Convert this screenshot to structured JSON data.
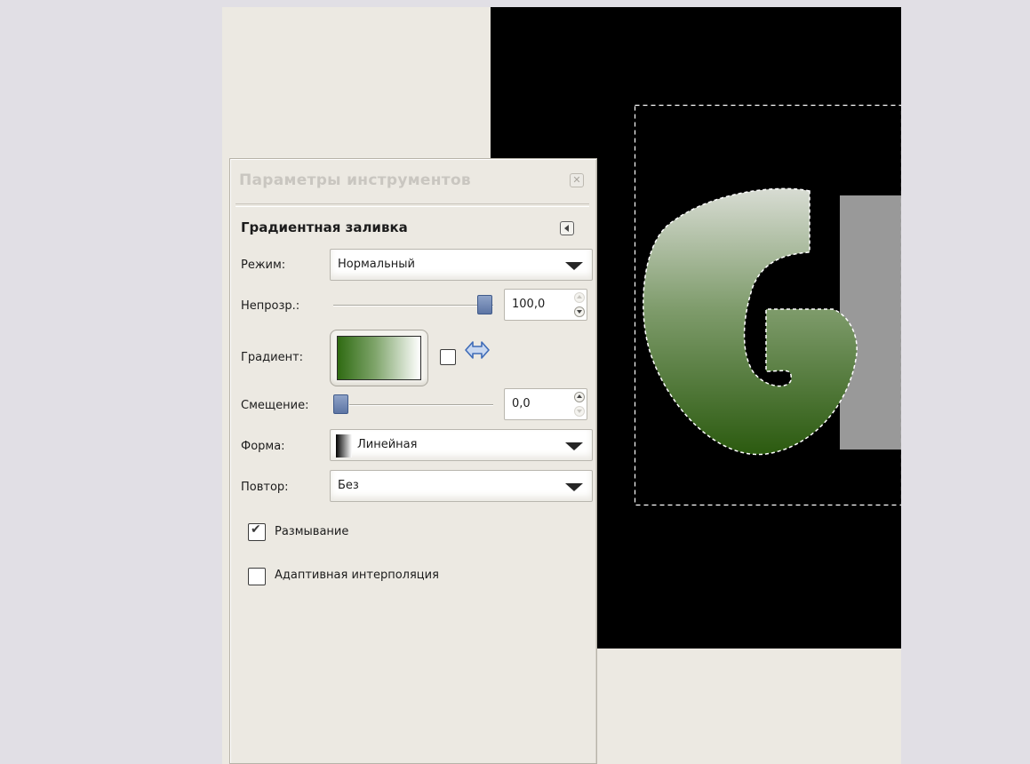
{
  "panel": {
    "title": "Параметры инструментов",
    "section_title": "Градиентная заливка"
  },
  "mode": {
    "label": "Режим:",
    "value": "Нормальный"
  },
  "opacity": {
    "label": "Непрозр.:",
    "value": "100,0",
    "fraction": 1.0
  },
  "gradient": {
    "label": "Градиент:",
    "reverse_checked": false
  },
  "offset": {
    "label": "Смещение:",
    "value": "0,0",
    "fraction": 0.0
  },
  "shape": {
    "label": "Форма:",
    "value": "Линейная"
  },
  "repeat": {
    "label": "Повтор:",
    "value": "Без"
  },
  "dither": {
    "label": "Размывание",
    "checked": true
  },
  "adaptive": {
    "label": "Адаптивная интерполяция",
    "checked": false
  },
  "canvas": {
    "letter": "G"
  },
  "icons": {
    "close": "close-icon",
    "collapse": "collapse-icon",
    "reverse": "reverse-gradient-icon",
    "dropdown": "chevron-down-icon"
  },
  "colors": {
    "gradient_start": "#2f6b12",
    "gradient_end": "#ffffff",
    "slider_handle": "#6d84b3"
  }
}
